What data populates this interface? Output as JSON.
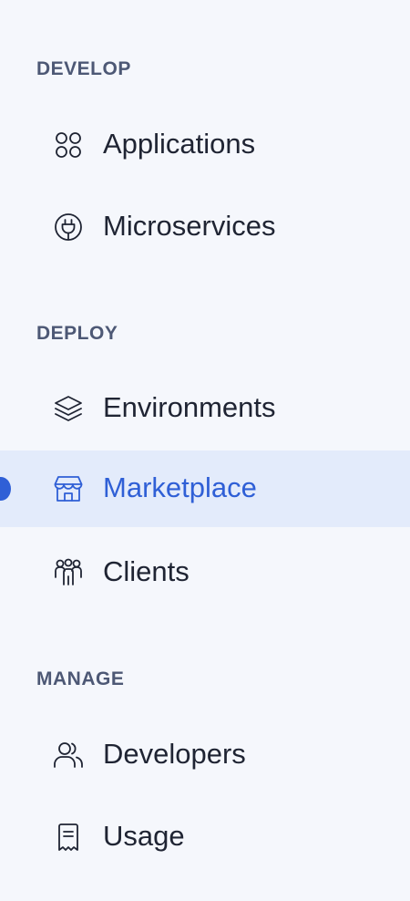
{
  "sections": [
    {
      "title": "DEVELOP",
      "items": [
        {
          "label": "Applications",
          "icon": "apps-icon"
        },
        {
          "label": "Microservices",
          "icon": "plug-icon"
        }
      ]
    },
    {
      "title": "DEPLOY",
      "items": [
        {
          "label": "Environments",
          "icon": "layers-icon"
        },
        {
          "label": "Marketplace",
          "icon": "store-icon",
          "active": true
        },
        {
          "label": "Clients",
          "icon": "clients-icon"
        }
      ]
    },
    {
      "title": "MANAGE",
      "items": [
        {
          "label": "Developers",
          "icon": "users-icon"
        },
        {
          "label": "Usage",
          "icon": "receipt-icon"
        }
      ]
    }
  ],
  "colors": {
    "background": "#f5f7fc",
    "section_title": "#4d5875",
    "text": "#1f2433",
    "accent": "#2f5fd6",
    "active_background": "#e3ebfb"
  }
}
